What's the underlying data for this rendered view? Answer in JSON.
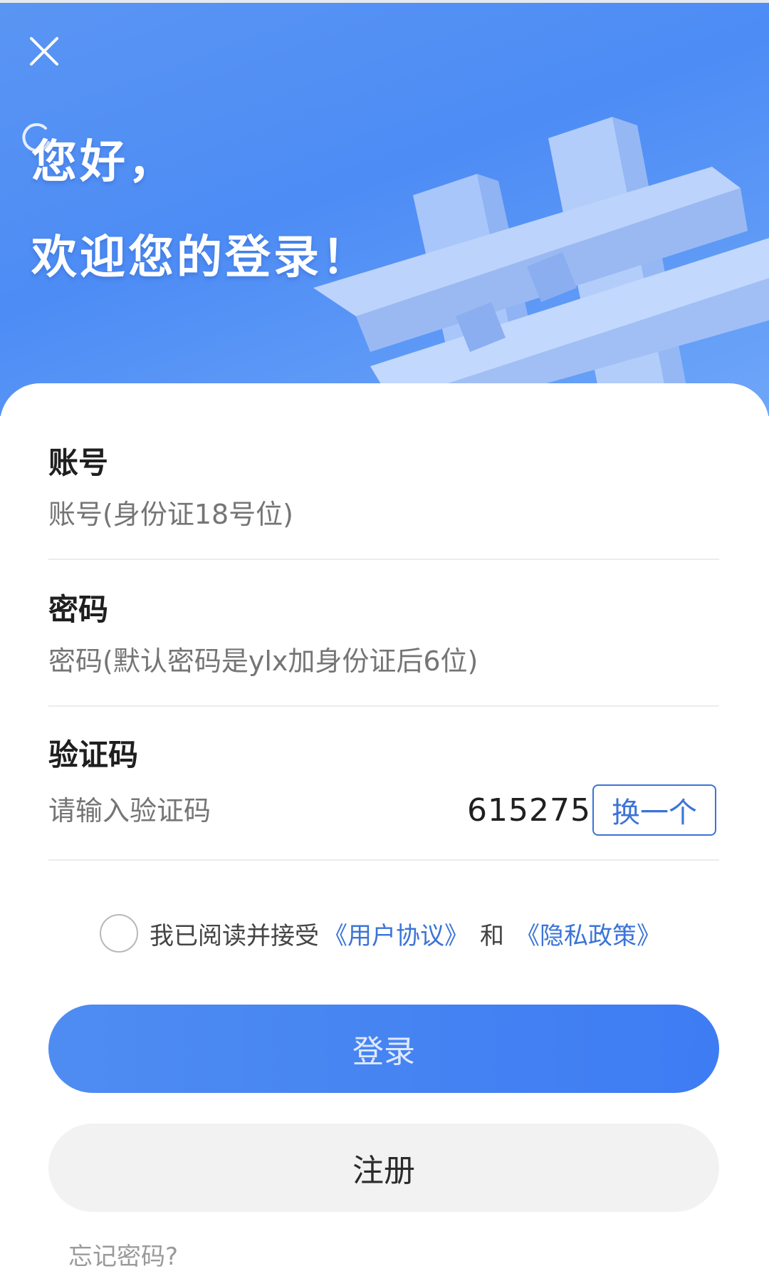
{
  "header": {
    "greeting_line1": "您好，",
    "greeting_line2": "欢迎您的登录！",
    "close_icon": "close-icon",
    "background_color": "#4d8cf5"
  },
  "form": {
    "account": {
      "label": "账号",
      "placeholder": "账号(身份证18号位)"
    },
    "password": {
      "label": "密码",
      "placeholder": "密码(默认密码是ylx加身份证后6位)"
    },
    "captcha": {
      "label": "验证码",
      "placeholder": "请输入验证码",
      "code": "615275",
      "refresh_label": "换一个"
    }
  },
  "agreement": {
    "checked": false,
    "prefix": "我已阅读并接受",
    "user_agreement": "《用户协议》",
    "and": "和",
    "privacy_policy": "《隐私政策》",
    "link_color": "#3b74d8"
  },
  "actions": {
    "login_label": "登录",
    "register_label": "注册",
    "forgot_label": "忘记密码?"
  }
}
